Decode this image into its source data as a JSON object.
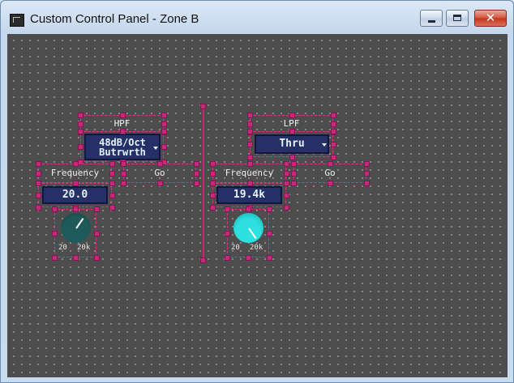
{
  "window": {
    "title": "Custom Control Panel - Zone B",
    "buttons": {
      "minimize": "minimize",
      "maximize": "maximize",
      "close": "✕"
    }
  },
  "hpf": {
    "title": "HPF",
    "slope_line1": "48dB/Oct",
    "slope_line2": "Butrwrth",
    "freq_label": "Frequency",
    "freq_value": "20.0",
    "go_label": "Go",
    "knob_min": "20",
    "knob_max": "20k",
    "knob_color": "#1f5a5a",
    "knob_level": 0.05
  },
  "lpf": {
    "title": "LPF",
    "slope_value": "Thru",
    "freq_label": "Frequency",
    "freq_value": "19.4k",
    "go_label": "Go",
    "knob_min": "20",
    "knob_max": "20k",
    "knob_color": "#1fcfcf",
    "knob_level": 0.99
  },
  "colors": {
    "canvas": "#4d4d4d",
    "selection": "#e0328a",
    "value_box": "#273066"
  }
}
